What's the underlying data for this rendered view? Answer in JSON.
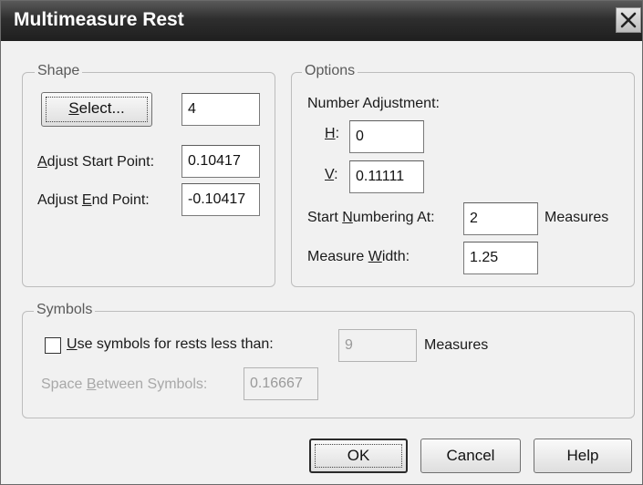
{
  "window": {
    "title": "Multimeasure Rest"
  },
  "shape": {
    "legend": "Shape",
    "select_button": {
      "pre": "",
      "mnemonic": "S",
      "post": "elect..."
    },
    "select_value": "4",
    "adjust_start": {
      "pre": "",
      "mnemonic": "A",
      "post": "djust Start Point:",
      "value": "0.10417"
    },
    "adjust_end": {
      "pre": "Adjust ",
      "mnemonic": "E",
      "post": "nd Point:",
      "value": "-0.10417"
    }
  },
  "options": {
    "legend": "Options",
    "number_adjustment_label": "Number Adjustment:",
    "h": {
      "mnemonic": "H",
      "post": ":",
      "value": "0"
    },
    "v": {
      "mnemonic": "V",
      "post": ":",
      "value": "0.11111"
    },
    "start_numbering": {
      "pre": "Start ",
      "mnemonic": "N",
      "post": "umbering At:",
      "value": "2",
      "unit": "Measures"
    },
    "measure_width": {
      "pre": "Measure ",
      "mnemonic": "W",
      "post": "idth:",
      "value": "1.25"
    }
  },
  "symbols": {
    "legend": "Symbols",
    "use_symbols": {
      "checked": false,
      "pre": "",
      "mnemonic": "U",
      "post": "se symbols for rests less than:",
      "value": "9",
      "unit": "Measures"
    },
    "space_between": {
      "pre": "Space ",
      "mnemonic": "B",
      "post": "etween Symbols:",
      "value": "0.16667"
    }
  },
  "buttons": {
    "ok": "OK",
    "cancel": "Cancel",
    "help": "Help"
  },
  "colors": {
    "titlebar": "#2e2e2e",
    "dialog_bg": "#f1f1f1",
    "disabled_text": "#a8a8a8"
  }
}
